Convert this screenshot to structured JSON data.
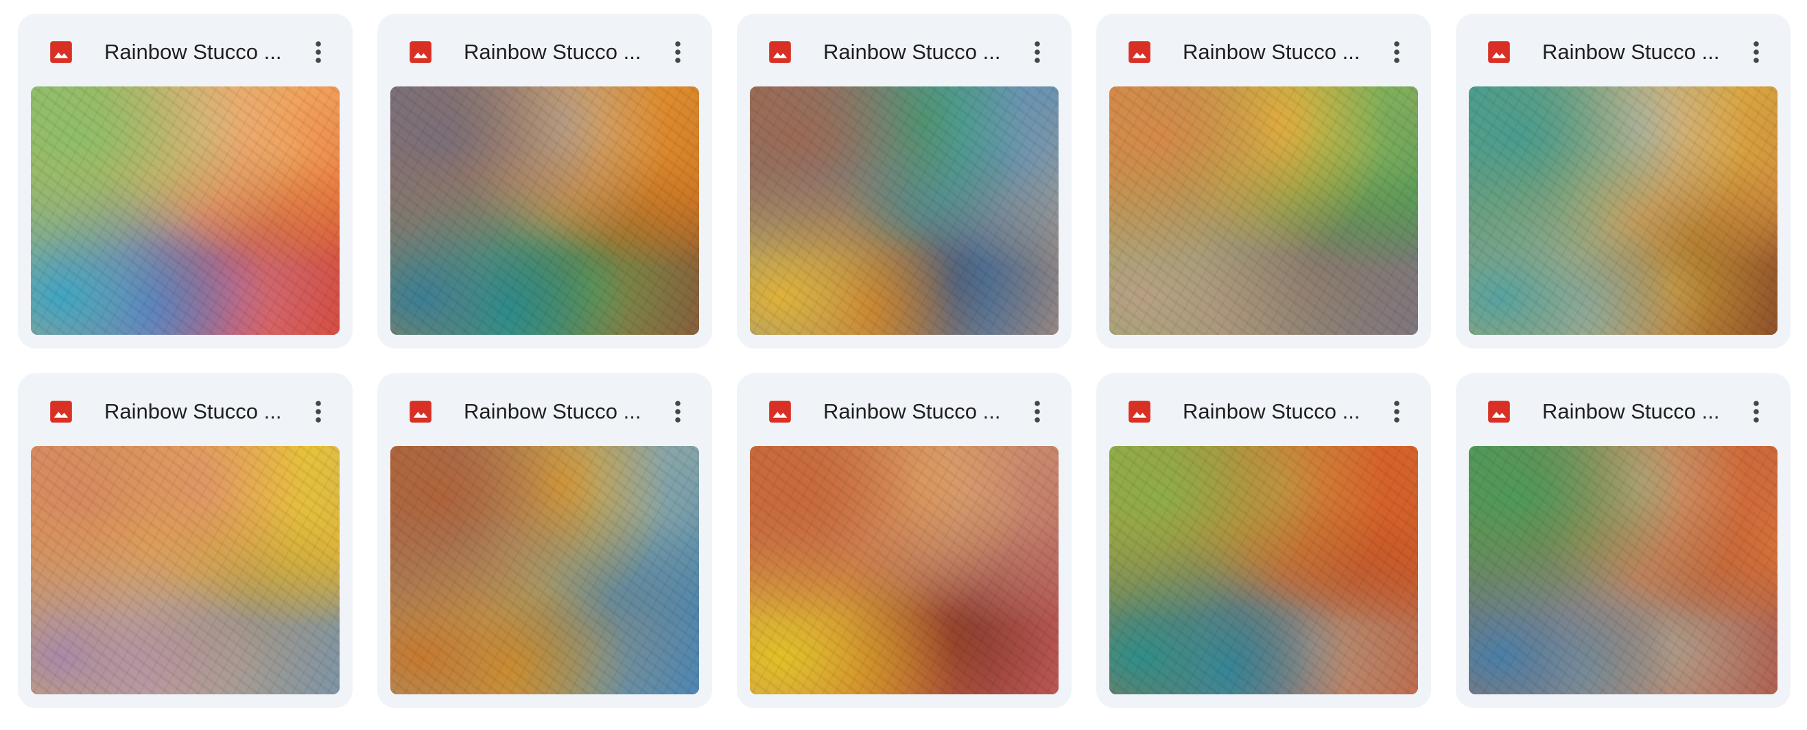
{
  "colors": {
    "card_background": "#f0f4f9",
    "image_icon_red": "#d93025",
    "title_text": "#1f1f1f",
    "more_icon": "#444746"
  },
  "cards": [
    {
      "title": "Rainbow Stucco ...",
      "file_icon": "image-file-icon",
      "menu_icon": "more-vert-icon",
      "palette": [
        "#8fbf6a",
        "#e9b27c",
        "#f2a25a",
        "#e4582a",
        "#3fa6c4",
        "#7a6bc0",
        "#e87a8e",
        "#d84a3c"
      ]
    },
    {
      "title": "Rainbow Stucco ...",
      "file_icon": "image-file-icon",
      "menu_icon": "more-vert-icon",
      "palette": [
        "#7a6f7a",
        "#c8a985",
        "#e08c2c",
        "#c66a1e",
        "#3b7f95",
        "#1f9d83",
        "#7fa356",
        "#8a5a3a"
      ]
    },
    {
      "title": "Rainbow Stucco ...",
      "file_icon": "image-file-icon",
      "menu_icon": "more-vert-icon",
      "palette": [
        "#9b6b55",
        "#3aa07a",
        "#6a95b3",
        "#b09a8a",
        "#e0b23a",
        "#c0662a",
        "#3f72a8",
        "#a08a80"
      ]
    },
    {
      "title": "Rainbow Stucco ...",
      "file_icon": "image-file-icon",
      "menu_icon": "more-vert-icon",
      "palette": [
        "#d68a4a",
        "#e3b63c",
        "#7fb05a",
        "#3f8f5a",
        "#b8a085",
        "#a58e78",
        "#9c8a7e",
        "#7f7680"
      ]
    },
    {
      "title": "Rainbow Stucco ...",
      "file_icon": "image-file-icon",
      "menu_icon": "more-vert-icon",
      "palette": [
        "#4a9d8f",
        "#cbb89a",
        "#dba640",
        "#c9783a",
        "#57a3a0",
        "#c9b290",
        "#d8a23a",
        "#8a4a2a"
      ]
    },
    {
      "title": "Rainbow Stucco ...",
      "file_icon": "image-file-icon",
      "menu_icon": "more-vert-icon",
      "palette": [
        "#d78a62",
        "#e39968",
        "#e8c23a",
        "#d9a93b",
        "#a88aa8",
        "#c9a6a0",
        "#b7aaa2",
        "#7a95a8"
      ]
    },
    {
      "title": "Rainbow Stucco ...",
      "file_icon": "image-file-icon",
      "menu_icon": "more-vert-icon",
      "palette": [
        "#b0643a",
        "#d9a53a",
        "#89a6a8",
        "#3d7fb0",
        "#c77a30",
        "#d4a233",
        "#8aa0a2",
        "#4a86b8"
      ]
    },
    {
      "title": "Rainbow Stucco ...",
      "file_icon": "image-file-icon",
      "menu_icon": "more-vert-icon",
      "palette": [
        "#c96a3a",
        "#e0a66a",
        "#c98a6e",
        "#b5575a",
        "#e2c127",
        "#c8682e",
        "#9a4030",
        "#c25a5a"
      ]
    },
    {
      "title": "Rainbow Stucco ...",
      "file_icon": "image-file-icon",
      "menu_icon": "more-vert-icon",
      "palette": [
        "#8fae4a",
        "#cf8a3c",
        "#d7622a",
        "#c85628",
        "#2f8f8a",
        "#3f7fa8",
        "#c9a58a",
        "#c06a4a"
      ]
    },
    {
      "title": "Rainbow Stucco ...",
      "file_icon": "image-file-icon",
      "menu_icon": "more-vert-icon",
      "palette": [
        "#4f9a5a",
        "#c9a27a",
        "#d06a3a",
        "#e07a3a",
        "#4a7fa8",
        "#a69a8a",
        "#c8b09a",
        "#b05a4a"
      ]
    }
  ]
}
